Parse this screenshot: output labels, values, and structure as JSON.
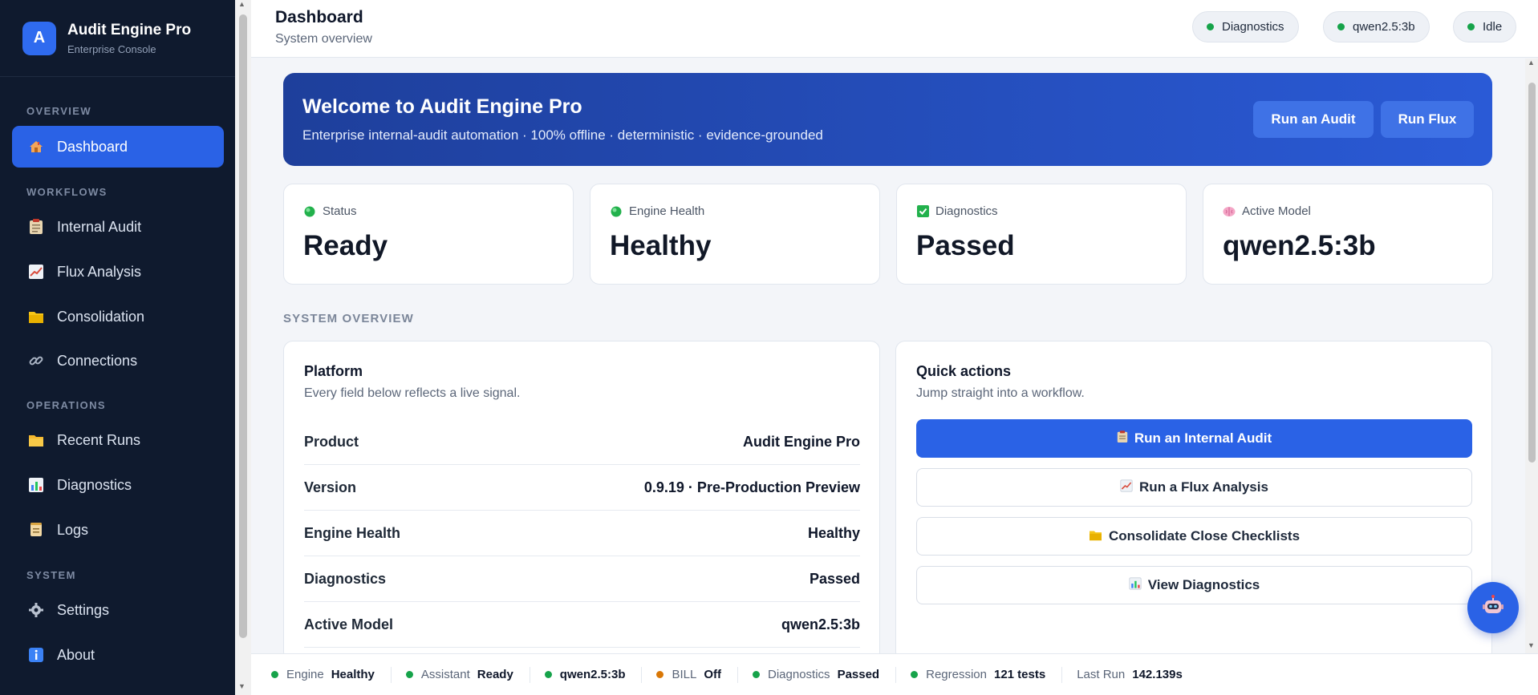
{
  "brand": {
    "logo_letter": "A",
    "title": "Audit Engine Pro",
    "subtitle": "Enterprise Console"
  },
  "sidebar": {
    "sections": [
      "OVERVIEW",
      "WORKFLOWS",
      "OPERATIONS",
      "SYSTEM"
    ],
    "items": [
      {
        "label": "Dashboard",
        "icon": "house-icon",
        "active": true
      },
      {
        "label": "Internal Audit",
        "icon": "clipboard-icon"
      },
      {
        "label": "Flux Analysis",
        "icon": "trend-chart-icon"
      },
      {
        "label": "Consolidation",
        "icon": "folder-tabs-icon"
      },
      {
        "label": "Connections",
        "icon": "link-icon"
      },
      {
        "label": "Recent Runs",
        "icon": "folder-icon"
      },
      {
        "label": "Diagnostics",
        "icon": "bar-chart-icon"
      },
      {
        "label": "Logs",
        "icon": "scroll-icon"
      },
      {
        "label": "Settings",
        "icon": "gear-icon"
      },
      {
        "label": "About",
        "icon": "info-icon"
      }
    ]
  },
  "header": {
    "title": "Dashboard",
    "subtitle": "System overview",
    "pills": [
      "Diagnostics",
      "qwen2.5:3b",
      "Idle"
    ]
  },
  "hero": {
    "title": "Welcome to Audit Engine Pro",
    "subtitle": "Enterprise internal-audit automation · 100% offline · deterministic · evidence-grounded",
    "buttons": [
      "Run an Audit",
      "Run Flux"
    ]
  },
  "stats": [
    {
      "label": "Status",
      "value": "Ready",
      "icon": "green-circle-icon"
    },
    {
      "label": "Engine Health",
      "value": "Healthy",
      "icon": "green-circle-icon"
    },
    {
      "label": "Diagnostics",
      "value": "Passed",
      "icon": "check-box-icon"
    },
    {
      "label": "Active Model",
      "value": "qwen2.5:3b",
      "icon": "brain-icon"
    }
  ],
  "section_label": "SYSTEM OVERVIEW",
  "platform": {
    "title": "Platform",
    "subtitle": "Every field below reflects a live signal.",
    "rows": [
      {
        "key": "Product",
        "value": "Audit Engine Pro"
      },
      {
        "key": "Version",
        "value": "0.9.19 · Pre-Production Preview"
      },
      {
        "key": "Engine Health",
        "value": "Healthy"
      },
      {
        "key": "Diagnostics",
        "value": "Passed"
      },
      {
        "key": "Active Model",
        "value": "qwen2.5:3b"
      }
    ]
  },
  "quick_actions": {
    "title": "Quick actions",
    "subtitle": "Jump straight into a workflow.",
    "buttons": [
      {
        "label": "Run an Internal Audit",
        "icon": "clipboard-icon",
        "primary": true
      },
      {
        "label": "Run a Flux Analysis",
        "icon": "trend-chart-icon"
      },
      {
        "label": "Consolidate Close Checklists",
        "icon": "folder-tabs-icon"
      },
      {
        "label": "View Diagnostics",
        "icon": "bar-chart-icon"
      }
    ]
  },
  "statusbar": [
    {
      "label": "Engine",
      "value": "Healthy",
      "dot": "green"
    },
    {
      "label": "Assistant",
      "value": "Ready",
      "dot": "green"
    },
    {
      "label": "",
      "value": "qwen2.5:3b",
      "dot": "green"
    },
    {
      "label": "BILL",
      "value": "Off",
      "dot": "amber"
    },
    {
      "label": "Diagnostics",
      "value": "Passed",
      "dot": "green"
    },
    {
      "label": "Regression",
      "value": "121 tests",
      "dot": "green"
    },
    {
      "label": "Last Run",
      "value": "142.139s",
      "dot": ""
    }
  ],
  "colors": {
    "accent": "#2a62e6",
    "sidebar_bg": "#0f1a2e",
    "ok": "#16a34a",
    "warn": "#d97706"
  }
}
